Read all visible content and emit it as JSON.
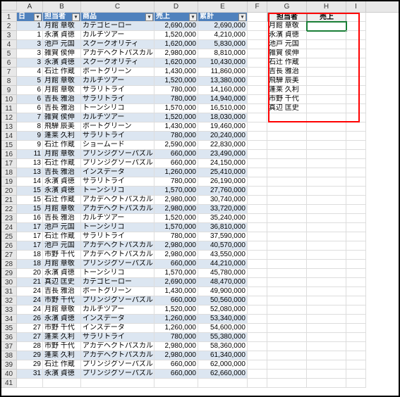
{
  "columns": [
    "A",
    "B",
    "C",
    "D",
    "E",
    "F",
    "G",
    "H",
    "I"
  ],
  "table_headers": {
    "day": "日",
    "person": "担当者",
    "product": "商品",
    "sales": "売上",
    "total": "累計"
  },
  "side_headers": {
    "person": "担当者",
    "sales": "売上"
  },
  "rows": [
    {
      "n": 1,
      "d": 1,
      "p": "月館 章敬",
      "prod": "カテゴヒーロー",
      "s": "2,690,000",
      "t": "2,690,000"
    },
    {
      "n": 2,
      "d": 1,
      "p": "永濱 貞徳",
      "prod": "カルチツアー",
      "s": "1,520,000",
      "t": "4,210,000"
    },
    {
      "n": 3,
      "d": 3,
      "p": "池戸 元国",
      "prod": "スクークオリティ",
      "s": "1,620,000",
      "t": "5,830,000"
    },
    {
      "n": 4,
      "d": 3,
      "p": "雑賀 侯伸",
      "prod": "アカデヘクトパスカル",
      "s": "2,980,000",
      "t": "8,810,000"
    },
    {
      "n": 5,
      "d": 3,
      "p": "永濱 貞徳",
      "prod": "スクークオリティ",
      "s": "1,620,000",
      "t": "10,430,000"
    },
    {
      "n": 6,
      "d": 4,
      "p": "石辻 作蔵",
      "prod": "ポートグリーン",
      "s": "1,430,000",
      "t": "11,860,000"
    },
    {
      "n": 7,
      "d": 5,
      "p": "月館 章敬",
      "prod": "カルチツアー",
      "s": "1,520,000",
      "t": "13,380,000"
    },
    {
      "n": 8,
      "d": 6,
      "p": "月館 章敬",
      "prod": "サラリトライ",
      "s": "780,000",
      "t": "14,160,000"
    },
    {
      "n": 9,
      "d": 6,
      "p": "吉長 雅治",
      "prod": "サラリトライ",
      "s": "780,000",
      "t": "14,940,000"
    },
    {
      "n": 10,
      "d": 6,
      "p": "吉長 雅治",
      "prod": "トーンシリコ",
      "s": "1,570,000",
      "t": "16,510,000"
    },
    {
      "n": 11,
      "d": 7,
      "p": "雑賀 侯伸",
      "prod": "カルチツアー",
      "s": "1,520,000",
      "t": "18,030,000"
    },
    {
      "n": 12,
      "d": 8,
      "p": "飛騨 辰美",
      "prod": "ポートグリーン",
      "s": "1,430,000",
      "t": "19,460,000"
    },
    {
      "n": 13,
      "d": 9,
      "p": "蓬莱 久利",
      "prod": "サラリトライ",
      "s": "780,000",
      "t": "20,240,000"
    },
    {
      "n": 14,
      "d": 9,
      "p": "石辻 作蔵",
      "prod": "ショームード",
      "s": "2,590,000",
      "t": "22,830,000"
    },
    {
      "n": 15,
      "d": 11,
      "p": "月館 章敬",
      "prod": "プリンジグソーパズル",
      "s": "660,000",
      "t": "23,490,000"
    },
    {
      "n": 16,
      "d": 13,
      "p": "石辻 作蔵",
      "prod": "プリンジグソーパズル",
      "s": "660,000",
      "t": "24,150,000"
    },
    {
      "n": 17,
      "d": 13,
      "p": "吉長 雅治",
      "prod": "インスデータ",
      "s": "1,260,000",
      "t": "25,410,000"
    },
    {
      "n": 18,
      "d": 14,
      "p": "永濱 貞徳",
      "prod": "サラリトライ",
      "s": "780,000",
      "t": "26,190,000"
    },
    {
      "n": 19,
      "d": 15,
      "p": "永濱 貞徳",
      "prod": "トーンシリコ",
      "s": "1,570,000",
      "t": "27,760,000"
    },
    {
      "n": 20,
      "d": 15,
      "p": "石辻 作蔵",
      "prod": "アカデヘクトパスカル",
      "s": "2,980,000",
      "t": "30,740,000"
    },
    {
      "n": 21,
      "d": 15,
      "p": "月館 章敬",
      "prod": "アカデヘクトパスカル",
      "s": "2,980,000",
      "t": "33,720,000"
    },
    {
      "n": 22,
      "d": 16,
      "p": "吉長 雅治",
      "prod": "カルチツアー",
      "s": "1,520,000",
      "t": "35,240,000"
    },
    {
      "n": 23,
      "d": 17,
      "p": "池戸 元国",
      "prod": "トーンシリコ",
      "s": "1,570,000",
      "t": "36,810,000"
    },
    {
      "n": 24,
      "d": 17,
      "p": "石辻 作蔵",
      "prod": "サラリトライ",
      "s": "780,000",
      "t": "37,590,000"
    },
    {
      "n": 25,
      "d": 17,
      "p": "池戸 元国",
      "prod": "アカデヘクトパスカル",
      "s": "2,980,000",
      "t": "40,570,000"
    },
    {
      "n": 26,
      "d": 18,
      "p": "市野 千代",
      "prod": "アカデヘクトパスカル",
      "s": "2,980,000",
      "t": "43,550,000"
    },
    {
      "n": 27,
      "d": 18,
      "p": "月館 章敬",
      "prod": "プリンジグソーパズル",
      "s": "660,000",
      "t": "44,210,000"
    },
    {
      "n": 28,
      "d": 20,
      "p": "永濱 貞徳",
      "prod": "トーンシリコ",
      "s": "1,570,000",
      "t": "45,780,000"
    },
    {
      "n": 29,
      "d": 21,
      "p": "真辺 匡史",
      "prod": "カテゴヒーロー",
      "s": "2,690,000",
      "t": "48,470,000"
    },
    {
      "n": 30,
      "d": 24,
      "p": "吉長 雅治",
      "prod": "ポートグリーン",
      "s": "1,430,000",
      "t": "49,900,000"
    },
    {
      "n": 31,
      "d": 24,
      "p": "市野 千代",
      "prod": "プリンジグソーパズル",
      "s": "660,000",
      "t": "50,560,000"
    },
    {
      "n": 32,
      "d": 24,
      "p": "月館 章敬",
      "prod": "カルチツアー",
      "s": "1,520,000",
      "t": "52,080,000"
    },
    {
      "n": 33,
      "d": 26,
      "p": "永濱 貞徳",
      "prod": "インスデータ",
      "s": "1,260,000",
      "t": "53,340,000"
    },
    {
      "n": 34,
      "d": 27,
      "p": "市野 千代",
      "prod": "インスデータ",
      "s": "1,260,000",
      "t": "54,600,000"
    },
    {
      "n": 35,
      "d": 27,
      "p": "蓬莱 久利",
      "prod": "サラリトライ",
      "s": "780,000",
      "t": "55,380,000"
    },
    {
      "n": 36,
      "d": 28,
      "p": "市野 千代",
      "prod": "アカデヘクトパスカル",
      "s": "2,980,000",
      "t": "58,360,000"
    },
    {
      "n": 37,
      "d": 29,
      "p": "蓬莱 久利",
      "prod": "アカデヘクトパスカル",
      "s": "2,980,000",
      "t": "61,340,000"
    },
    {
      "n": 38,
      "d": 29,
      "p": "石辻 作蔵",
      "prod": "プリンジグソーパズル",
      "s": "660,000",
      "t": "62,000,000"
    },
    {
      "n": 39,
      "d": 31,
      "p": "永濱 貞徳",
      "prod": "プリンジグソーパズル",
      "s": "660,000",
      "t": "62,660,000"
    }
  ],
  "side_list": [
    "月館 章敬",
    "永濱 貞徳",
    "池戸 元国",
    "雑賀 侯伸",
    "石辻 作蔵",
    "吉長 雅治",
    "飛騨 辰美",
    "蓬莱 久利",
    "市野 千代",
    "真辺 匡史"
  ],
  "filter_glyph": "▾"
}
